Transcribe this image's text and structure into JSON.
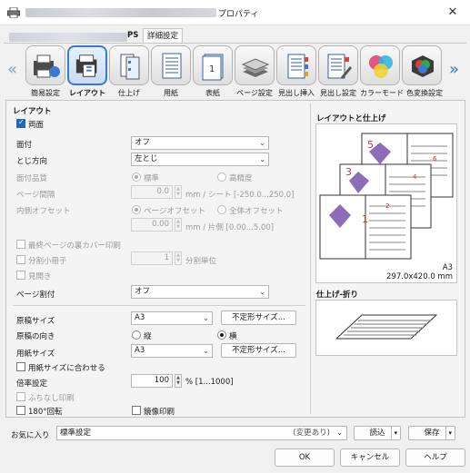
{
  "window": {
    "title_suffix": "プロパティ",
    "close_glyph": "✕"
  },
  "tabs": [
    {
      "label_suffix": "PS"
    },
    {
      "label": "詳細設定"
    }
  ],
  "toolbar": {
    "items": [
      {
        "label": "簡易設定",
        "icon": "quick-setup-icon"
      },
      {
        "label": "レイアウト",
        "icon": "layout-icon",
        "selected": true
      },
      {
        "label": "仕上げ",
        "icon": "finishing-icon"
      },
      {
        "label": "用紙",
        "icon": "paper-icon"
      },
      {
        "label": "表紙",
        "icon": "cover-icon"
      },
      {
        "label": "ページ設定",
        "icon": "page-setup-icon"
      },
      {
        "label": "見出し挿入",
        "icon": "tab-insert-icon"
      },
      {
        "label": "見出し設定",
        "icon": "tab-setup-icon"
      },
      {
        "label": "カラーモード",
        "icon": "color-mode-icon"
      },
      {
        "label": "色変換設定",
        "icon": "color-convert-icon"
      }
    ],
    "left_arrow": "«",
    "right_arrow": "»"
  },
  "layout": {
    "section_title": "レイアウト",
    "duplex": {
      "label": "両面",
      "checked": true
    },
    "binding": {
      "label": "面付",
      "value": "オフ"
    },
    "binding_direction": {
      "label": "とじ方向",
      "value": "左とじ"
    },
    "imposition_quality": {
      "label": "面付品質",
      "opt1": "標準",
      "opt2": "高精度"
    },
    "page_spacing": {
      "label": "ページ間隔",
      "value": "0.0",
      "unit": "mm / シート [-250.0...250.0]"
    },
    "inner_offset": {
      "label": "内側オフセット",
      "opt1": "ページオフセット",
      "opt2": "全体オフセット",
      "value": "0.00",
      "unit": "mm / 片側 [0.00...5.00]"
    },
    "last_page_back_cover": {
      "label": "最終ページの裏カバー印刷"
    },
    "split_booklet": {
      "label": "分割小冊子",
      "value": "1",
      "unit": "分割単位"
    },
    "spread": {
      "label": "見開き"
    },
    "page_split": {
      "label": "ページ割付",
      "value": "オフ"
    },
    "original_size": {
      "label": "原稿サイズ",
      "value": "A3",
      "button": "不定形サイズ..."
    },
    "orientation": {
      "label": "原稿の向き",
      "portrait": "縦",
      "landscape": "横"
    },
    "paper_size": {
      "label": "用紙サイズ",
      "value": "A3",
      "button": "不定形サイズ..."
    },
    "fit_to_paper": {
      "label": "用紙サイズに合わせる"
    },
    "zoom": {
      "label": "倍率設定",
      "value": "100",
      "unit": "% [1...1000]"
    },
    "borderless": {
      "label": "ふちなし印刷"
    },
    "rotate180": {
      "label": "180°回転"
    },
    "mirror": {
      "label": "鏡像印刷"
    }
  },
  "preview": {
    "title": "レイアウトと仕上げ",
    "paper_name": "A3",
    "paper_dims": "297.0x420.0 mm",
    "page_numbers": [
      "1",
      "2",
      "3",
      "4",
      "5",
      "6"
    ],
    "finish_title": "仕上げ-折り"
  },
  "footer": {
    "favorites_label": "お気に入り",
    "favorites_value": "標準設定",
    "favorites_status": "(変更あり)",
    "read_button": "読込",
    "save_button": "保存",
    "ok": "OK",
    "cancel": "キャンセル",
    "help": "ヘルプ"
  },
  "colors": {
    "accent": "#1f6ac0",
    "number_red": "#d03030"
  }
}
